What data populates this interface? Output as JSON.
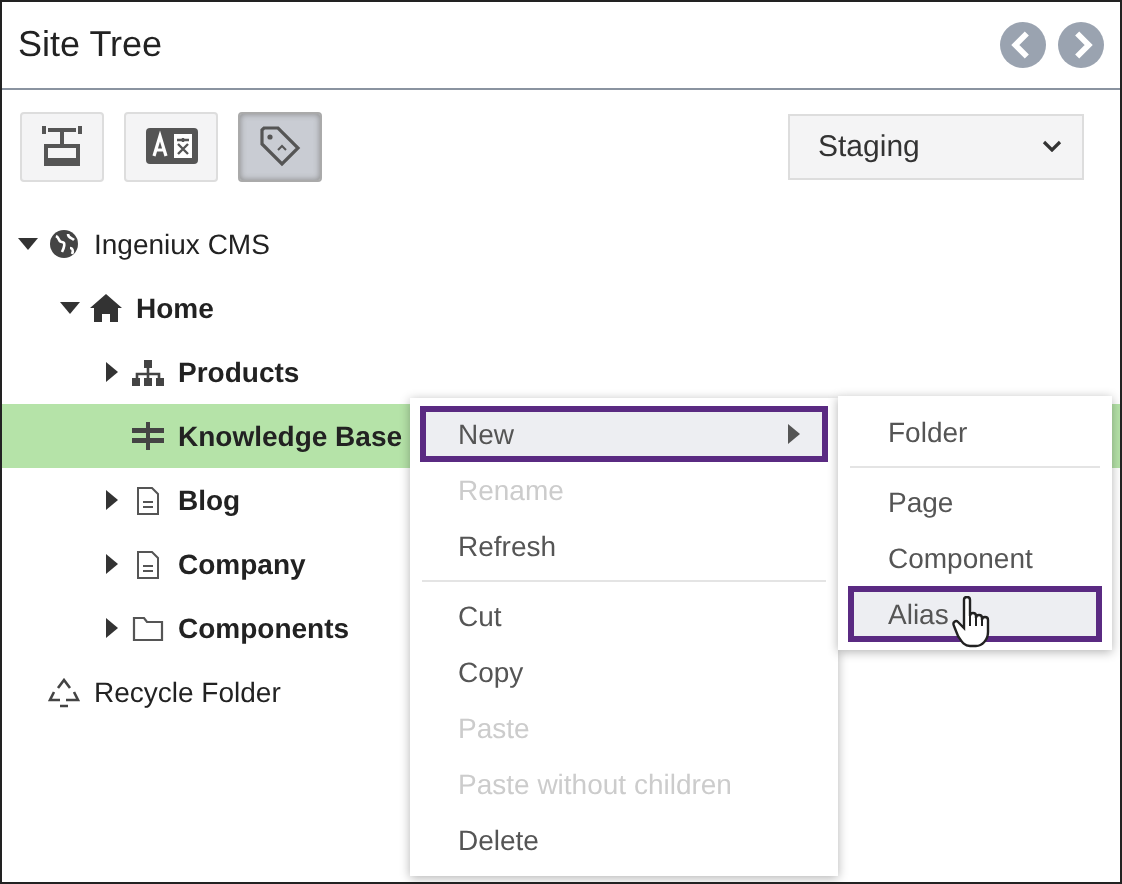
{
  "panel": {
    "title": "Site Tree"
  },
  "toolbar": {
    "buttons": [
      {
        "kind": "stamp",
        "selected": false
      },
      {
        "kind": "translate",
        "selected": false
      },
      {
        "kind": "tag",
        "selected": true
      }
    ],
    "environment": "Staging"
  },
  "tree": [
    {
      "label": "Ingeniux CMS",
      "kind": "globe",
      "expanded": true,
      "selected": false,
      "bold": false,
      "children": [
        {
          "label": "Home",
          "kind": "home",
          "expanded": true,
          "selected": false,
          "bold": true,
          "children": [
            {
              "label": "Products",
              "kind": "sitemap",
              "expanded": false,
              "selected": false,
              "bold": true
            },
            {
              "label": "Knowledge Base",
              "kind": "signpost",
              "selected": true,
              "bold": true
            },
            {
              "label": "Blog",
              "kind": "page",
              "expanded": false,
              "selected": false,
              "bold": true
            },
            {
              "label": "Company",
              "kind": "page",
              "expanded": false,
              "selected": false,
              "bold": true
            },
            {
              "label": "Components",
              "kind": "folder",
              "expanded": false,
              "selected": false,
              "bold": true
            }
          ]
        }
      ]
    },
    {
      "label": "Recycle Folder",
      "kind": "recycle",
      "selected": false,
      "bold": false
    }
  ],
  "context_menu": {
    "items": [
      {
        "label": "New",
        "disabled": false,
        "selected": true,
        "submenu": true
      },
      {
        "label": "Rename",
        "disabled": true,
        "selected": false
      },
      {
        "label": "Refresh",
        "disabled": false,
        "selected": false,
        "separator_after": true
      },
      {
        "label": "Cut",
        "disabled": false,
        "selected": false
      },
      {
        "label": "Copy",
        "disabled": false,
        "selected": false
      },
      {
        "label": "Paste",
        "disabled": true,
        "selected": false
      },
      {
        "label": "Paste without children",
        "disabled": true,
        "selected": false
      },
      {
        "label": "Delete",
        "disabled": false,
        "selected": false
      }
    ],
    "submenu": [
      {
        "label": "Folder",
        "selected": false,
        "separator_after": true
      },
      {
        "label": "Page",
        "selected": false
      },
      {
        "label": "Component",
        "selected": false
      },
      {
        "label": "Alias",
        "selected": true
      }
    ]
  }
}
